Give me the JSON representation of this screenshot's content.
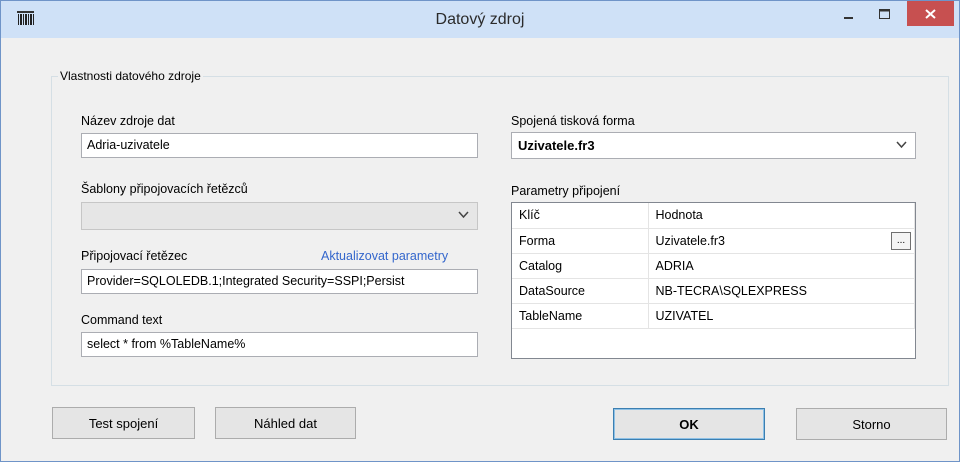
{
  "window": {
    "title": "Datový zdroj",
    "icon": "barcode-icon",
    "controls": {
      "minimize": "minimize-icon",
      "maximize": "maximize-icon",
      "close": "close-icon"
    }
  },
  "group": {
    "title": "Vlastnosti datového zdroje",
    "source_name": {
      "label": "Název zdroje dat",
      "value": "Adria-uzivatele"
    },
    "templates": {
      "label": "Šablony připojovacích řetězců",
      "value": ""
    },
    "connection": {
      "label": "Připojovací řetězec",
      "update_link": "Aktualizovat parametry",
      "value": "Provider=SQLOLEDB.1;Integrated Security=SSPI;Persist"
    },
    "command": {
      "label": "Command text",
      "value": "select * from %TableName%"
    },
    "print_form": {
      "label": "Spojená tisková forma",
      "value": "Uzivatele.fr3"
    },
    "params": {
      "label": "Parametry připojení",
      "header": {
        "key": "Klíč",
        "value": "Hodnota"
      },
      "rows": [
        {
          "key": "Forma",
          "value": "Uzivatele.fr3",
          "has_button": true
        },
        {
          "key": "Catalog",
          "value": "ADRIA"
        },
        {
          "key": "DataSource",
          "value": "NB-TECRA\\SQLEXPRESS"
        },
        {
          "key": "TableName",
          "value": "UZIVATEL"
        }
      ],
      "ellipsis": "..."
    }
  },
  "buttons": {
    "test": "Test spojení",
    "preview": "Náhled dat",
    "ok": "OK",
    "cancel": "Storno"
  }
}
